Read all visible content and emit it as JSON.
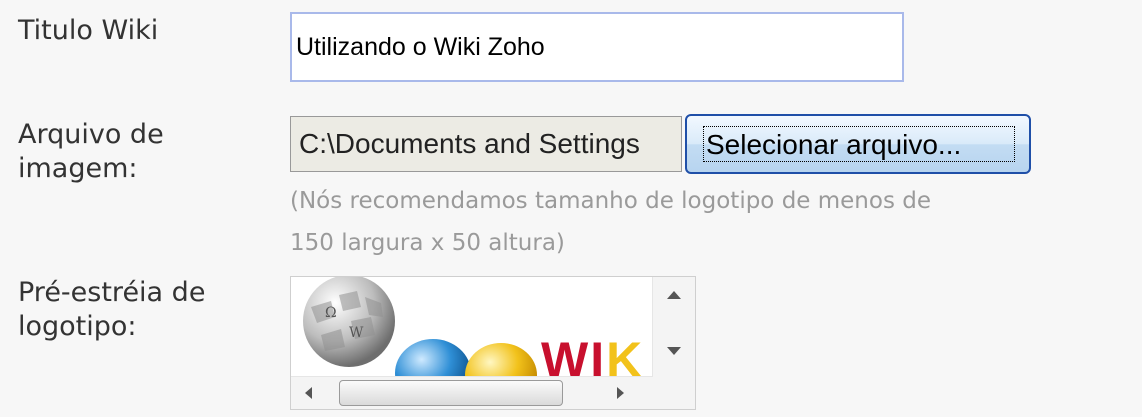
{
  "form": {
    "wiki_title_label": "Titulo Wiki",
    "wiki_title_value": "Utilizando o Wiki Zoho",
    "image_file_label_line1": "Arquivo de",
    "image_file_label_line2": "imagem:",
    "image_file_path": "C:\\Documents and Settings",
    "select_file_button": "Selecionar arquivo...",
    "size_hint_line1": "(Nós recomendamos tamanho de logotipo de menos de",
    "size_hint_line2": "150 largura x 50 altura)",
    "logo_preview_label_line1": "Pré-estréia de",
    "logo_preview_label_line2": "logotipo:"
  },
  "preview": {
    "image_text": "WIKI",
    "colors": {
      "globe_grey": "#bdbdbd",
      "blue_sphere": "#2f8fd6",
      "yellow_sphere": "#f2c21b",
      "red_text": "#c8102e",
      "yellow_text": "#f2c21b"
    }
  }
}
